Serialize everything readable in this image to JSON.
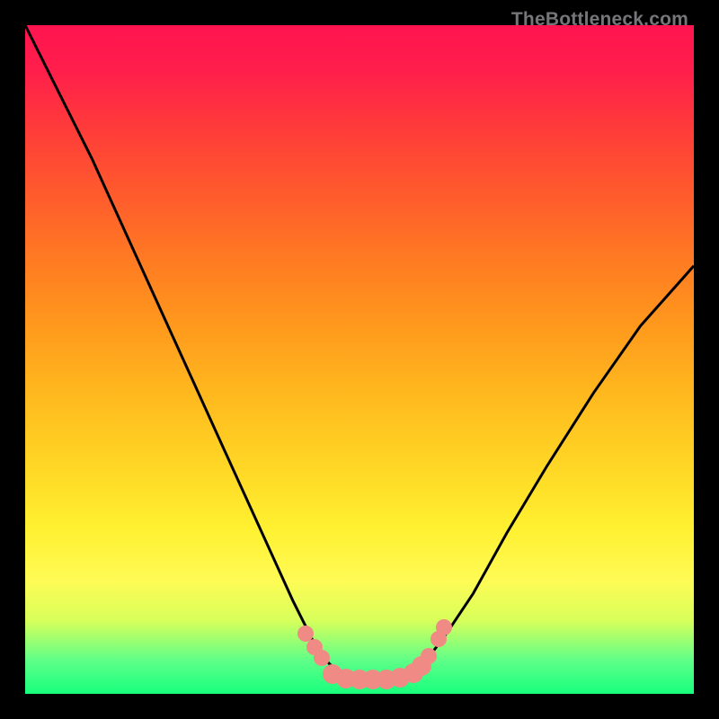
{
  "attribution": "TheBottleneck.com",
  "colors": {
    "curve": "#000000",
    "dots": "#f08a84",
    "border": "#000000"
  },
  "chart_data": {
    "type": "line",
    "title": "",
    "xlabel": "",
    "ylabel": "",
    "xlim": [
      0,
      100
    ],
    "ylim": [
      0,
      100
    ],
    "series": [
      {
        "name": "bottleneck-curve",
        "x": [
          0,
          5,
          10,
          15,
          20,
          25,
          30,
          35,
          40,
          44,
          47,
          50,
          53,
          55,
          58,
          60,
          63,
          67,
          72,
          78,
          85,
          92,
          100
        ],
        "y": [
          100,
          90,
          80,
          69,
          58,
          47,
          36,
          25,
          14,
          6,
          3,
          2,
          2,
          2,
          3,
          5,
          9,
          15,
          24,
          34,
          45,
          55,
          64
        ]
      }
    ],
    "markers": [
      {
        "x": 42.0,
        "y": 9.0
      },
      {
        "x": 43.3,
        "y": 7.0
      },
      {
        "x": 44.3,
        "y": 5.4
      },
      {
        "x": 46.0,
        "y": 3.0
      },
      {
        "x": 48.0,
        "y": 2.3
      },
      {
        "x": 50.0,
        "y": 2.2
      },
      {
        "x": 52.0,
        "y": 2.2
      },
      {
        "x": 54.0,
        "y": 2.2
      },
      {
        "x": 56.0,
        "y": 2.4
      },
      {
        "x": 58.0,
        "y": 3.1
      },
      {
        "x": 59.3,
        "y": 4.2
      },
      {
        "x": 60.3,
        "y": 5.6
      },
      {
        "x": 61.8,
        "y": 8.2
      },
      {
        "x": 62.6,
        "y": 10.0
      }
    ],
    "background_gradient": {
      "top": "#ff1450",
      "mid": "#fff030",
      "bottom": "#17ff7d"
    }
  }
}
